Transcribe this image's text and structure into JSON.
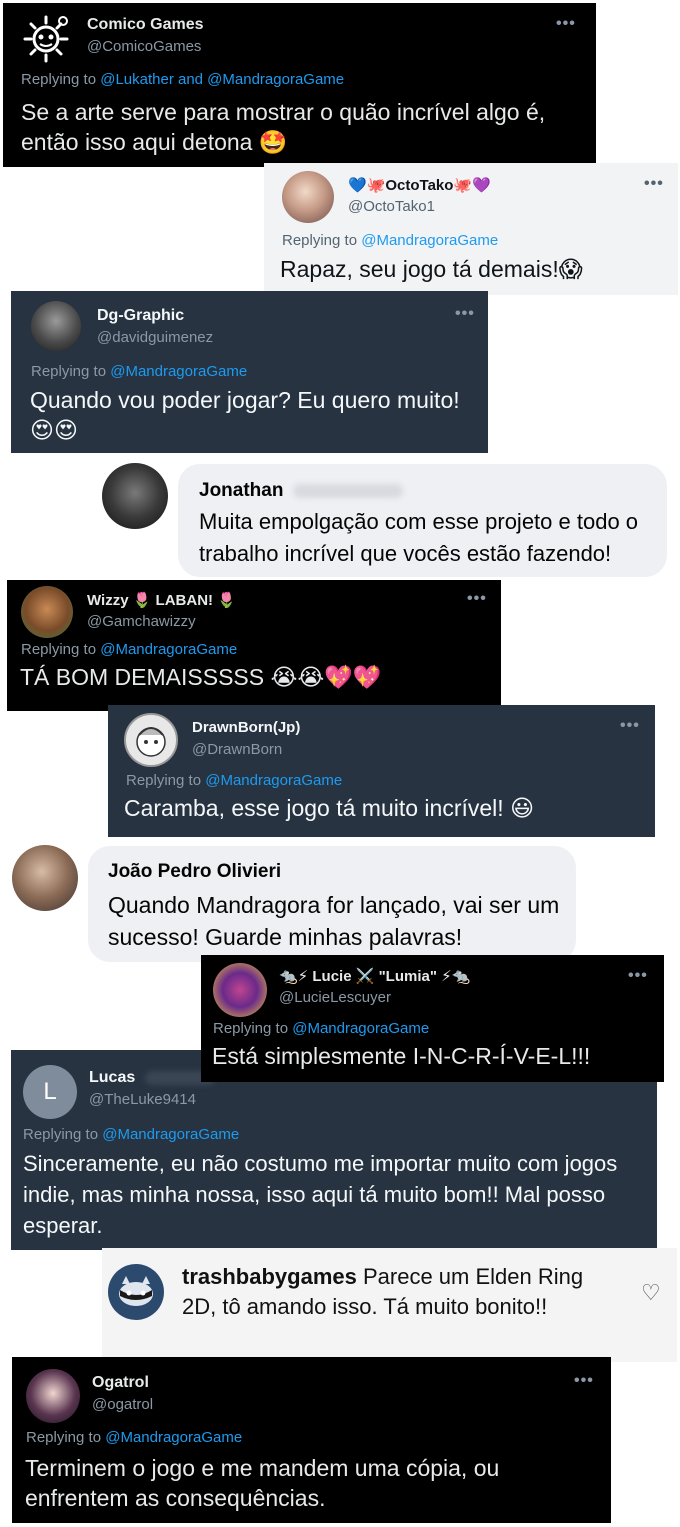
{
  "comments": {
    "c1": {
      "name": "Comico Games",
      "handle": "@ComicoGames",
      "reply_prefix": "Replying to ",
      "reply_to": "@Lukather and @MandragoraGame",
      "text": "Se a arte serve para mostrar o quão incrível algo é, então isso aqui detona",
      "emoji": "🤩",
      "menu": "•••"
    },
    "c2": {
      "name": "💙🐙OctoTako🐙💜",
      "handle": "@OctoTako1",
      "reply_prefix": "Replying to ",
      "reply_to": "@MandragoraGame",
      "text": "Rapaz, seu jogo tá demais!",
      "emoji": "😱",
      "menu": "•••"
    },
    "c3": {
      "name": "Dg-Graphic",
      "handle": "@davidguimenez",
      "reply_prefix": "Replying to ",
      "reply_to": "@MandragoraGame",
      "text": "Quando vou poder jogar? Eu quero muito!",
      "emoji": "😍😍",
      "menu": "•••"
    },
    "c4": {
      "name": "Jonathan",
      "text": "Muita empolgação com esse projeto e todo o trabalho incrível que vocês estão fazendo!"
    },
    "c5": {
      "name": "Wizzy 🌷 LABAN! 🌷",
      "handle": "@Gamchawizzy",
      "reply_prefix": "Replying to ",
      "reply_to": "@MandragoraGame",
      "text": "TÁ BOM DEMAISSSSS",
      "emoji": "😭😭💖💖",
      "menu": "•••"
    },
    "c6": {
      "name": "DrawnBorn(Jp)",
      "handle": "@DrawnBorn",
      "reply_prefix": "Replying to ",
      "reply_to": "@MandragoraGame",
      "text": "Caramba, esse jogo tá muito incrível!",
      "emoji": "😃",
      "menu": "•••"
    },
    "c7": {
      "name": "João Pedro Olivieri",
      "text": "Quando Mandragora for lançado, vai ser um sucesso! Guarde minhas palavras!"
    },
    "c8": {
      "name": "🐀⚡ Lucie ⚔️ \"Lumia\" ⚡🐀",
      "handle": "@LucieLescuyer",
      "reply_prefix": "Replying to ",
      "reply_to": "@MandragoraGame",
      "text": "Está simplesmente I-N-C-R-Í-V-E-L!!!",
      "menu": "•••"
    },
    "c9": {
      "name": "Lucas",
      "avatar_letter": "L",
      "handle": "@TheLuke9414",
      "reply_prefix": "Replying to ",
      "reply_to": "@MandragoraGame",
      "text": "Sinceramente, eu não costumo me importar muito com jogos indie, mas minha nossa, isso aqui tá muito bom!! Mal posso esperar."
    },
    "c10": {
      "name": "trashbabygames",
      "text": "Parece um Elden Ring 2D, tô amando isso. Tá muito bonito!!",
      "heart": "♡"
    },
    "c11": {
      "name": "Ogatrol",
      "handle": "@ogatrol",
      "reply_prefix": "Replying to ",
      "reply_to": "@MandragoraGame",
      "text": "Terminem o jogo e me mandem uma cópia, ou enfrentem as consequências.",
      "menu": "•••"
    }
  }
}
